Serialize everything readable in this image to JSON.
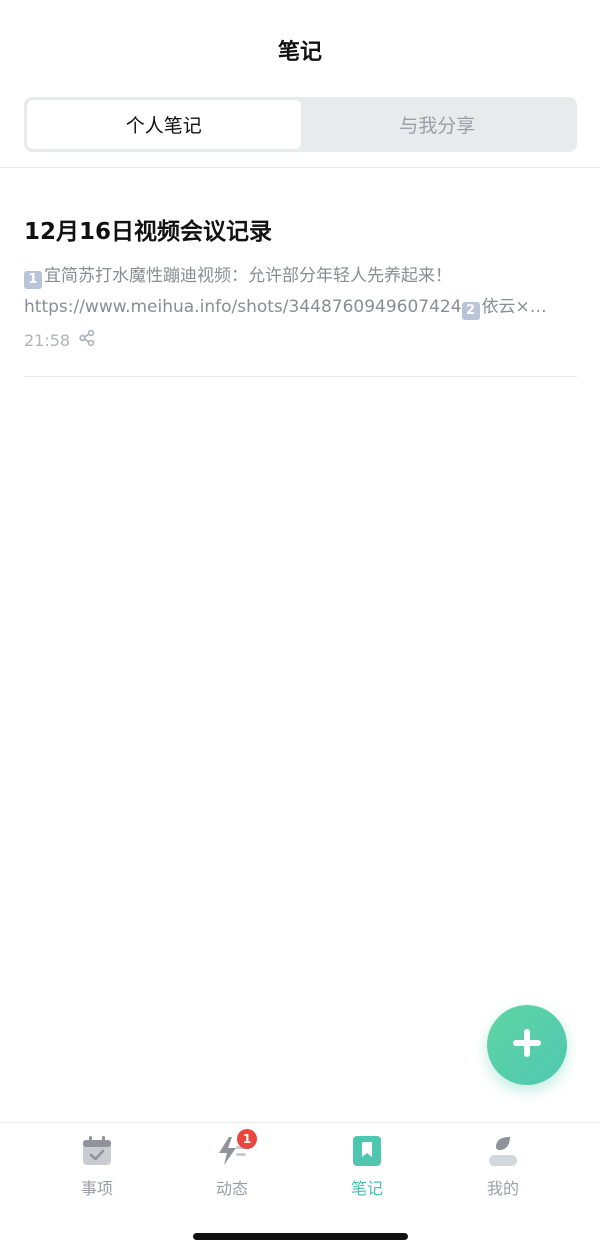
{
  "header": {
    "title": "笔记"
  },
  "segment": {
    "tabs": [
      {
        "label": "个人笔记",
        "active": true
      },
      {
        "label": "与我分享",
        "active": false
      }
    ]
  },
  "notes": [
    {
      "title": "12月16日视频会议记录",
      "line1_key": "1",
      "line1": "宜简苏打水魔性蹦迪视频：允许部分年轻人先养起来！",
      "line2_prefix": "https://www.meihua.info/shots/3448760949607424",
      "line2_key": "2",
      "line2_suffix": "依云×…",
      "time": "21:58",
      "share_icon": "share-icon"
    }
  ],
  "fab": {
    "icon": "plus-icon",
    "color": "#5fd6a5"
  },
  "tabbar": {
    "items": [
      {
        "label": "事项",
        "icon": "calendar-check-icon",
        "active": false
      },
      {
        "label": "动态",
        "icon": "activity-bolt-icon",
        "active": false,
        "badge": "1"
      },
      {
        "label": "笔记",
        "icon": "bookmark-icon",
        "active": true
      },
      {
        "label": "我的",
        "icon": "profile-icon",
        "active": false
      }
    ],
    "active_color": "#46c3b0",
    "inactive_color": "#9a9ea6"
  }
}
